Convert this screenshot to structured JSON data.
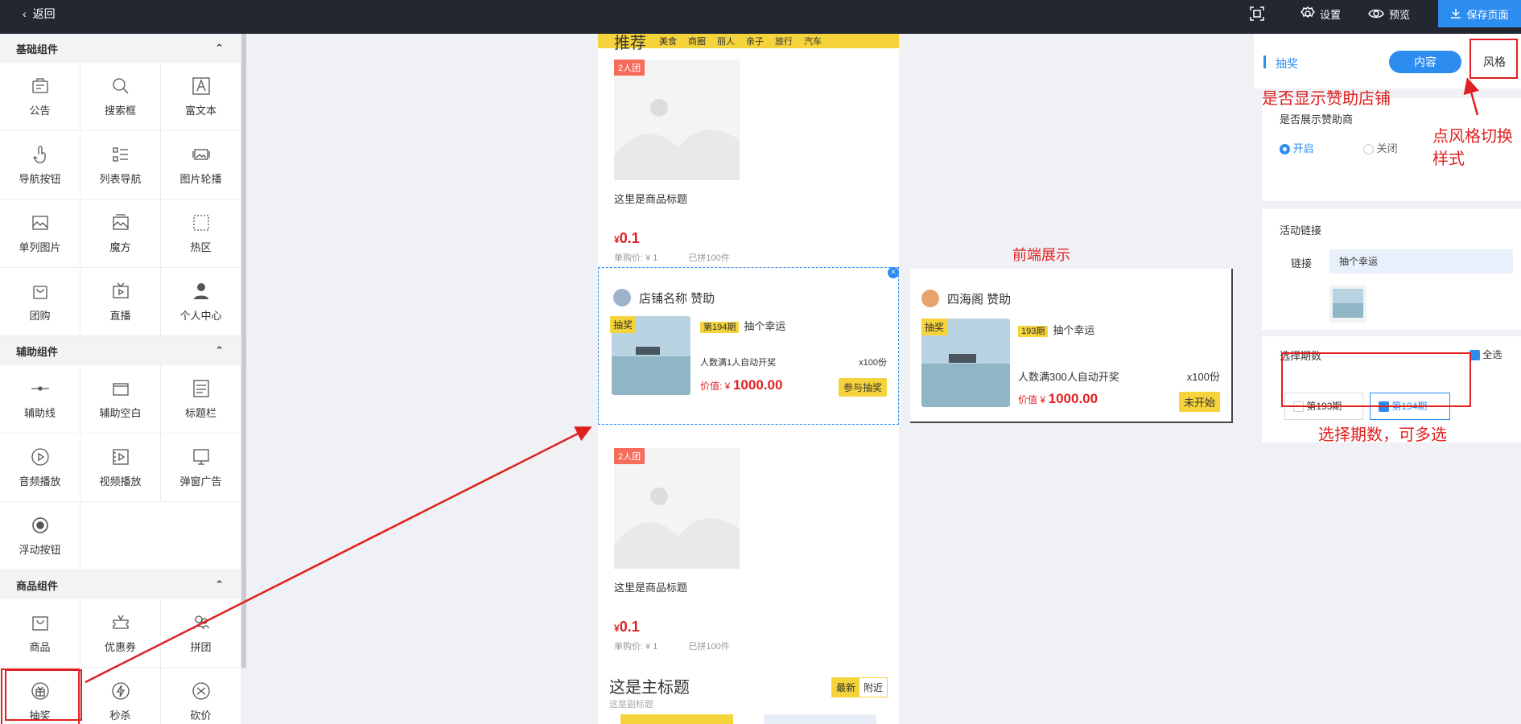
{
  "topbar": {
    "back": "返回",
    "settings": "设置",
    "preview": "预览",
    "save": "保存页面"
  },
  "sidebar": {
    "sections": [
      {
        "title": "基础组件",
        "items": [
          {
            "label": "公告",
            "icon": "notice-icon"
          },
          {
            "label": "搜索框",
            "icon": "search-icon"
          },
          {
            "label": "富文本",
            "icon": "rich-text-icon"
          },
          {
            "label": "导航按钮",
            "icon": "touch-icon"
          },
          {
            "label": "列表导航",
            "icon": "list-icon"
          },
          {
            "label": "图片轮播",
            "icon": "carousel-icon"
          },
          {
            "label": "单列图片",
            "icon": "image-icon"
          },
          {
            "label": "魔方",
            "icon": "cube-icon"
          },
          {
            "label": "热区",
            "icon": "hotspot-icon"
          },
          {
            "label": "团购",
            "icon": "bag-icon"
          },
          {
            "label": "直播",
            "icon": "tv-icon"
          },
          {
            "label": "个人中心",
            "icon": "user-icon"
          }
        ]
      },
      {
        "title": "辅助组件",
        "items": [
          {
            "label": "辅助线",
            "icon": "line-icon"
          },
          {
            "label": "辅助空白",
            "icon": "blank-icon"
          },
          {
            "label": "标题栏",
            "icon": "title-icon"
          },
          {
            "label": "音频播放",
            "icon": "audio-icon"
          },
          {
            "label": "视频播放",
            "icon": "video-icon"
          },
          {
            "label": "弹窗广告",
            "icon": "ad-icon"
          },
          {
            "label": "浮动按钮",
            "icon": "float-button-icon"
          }
        ]
      },
      {
        "title": "商品组件",
        "items": [
          {
            "label": "商品",
            "icon": "goods-icon"
          },
          {
            "label": "优惠券",
            "icon": "coupon-icon"
          },
          {
            "label": "拼团",
            "icon": "group-icon"
          },
          {
            "label": "抽奖",
            "icon": "gift-icon"
          },
          {
            "label": "秒杀",
            "icon": "flash-icon"
          },
          {
            "label": "砍价",
            "icon": "bargain-icon"
          }
        ]
      }
    ]
  },
  "phone": {
    "cats": {
      "main": "推荐",
      "items": [
        "美食",
        "商圈",
        "丽人",
        "亲子",
        "旅行",
        "汽车"
      ]
    },
    "product": {
      "tag": "2人团",
      "title": "这里是商品标题",
      "price": "0.1",
      "currency": "¥",
      "single": "单购价: ¥ 1",
      "sold": "已拼100件"
    },
    "lottery": {
      "shop": "店铺名称 赞助",
      "tag": "抽奖",
      "period": "第194期",
      "name": "抽个幸运",
      "rule": "人数满1人自动开奖",
      "count": "x100份",
      "value_label": "价值: ¥",
      "value": "1000.00",
      "btn": "参与抽奖"
    },
    "title_block": {
      "title": "这是主标题",
      "sub": "这是副标题",
      "tab_new": "最新",
      "tab_near": "附近"
    }
  },
  "frontend": {
    "caption": "前端展示",
    "shop": "四海阁 赞助",
    "tag": "抽奖",
    "period": "193期",
    "name": "抽个幸运",
    "rule": "人数满300人自动开奖",
    "count": "x100份",
    "value_label": "价值 ¥",
    "value": "1000.00",
    "status": "未开始"
  },
  "rpanel": {
    "title": "抽奖",
    "tab_content": "内容",
    "tab_style": "风格",
    "sponsor": {
      "label": "是否展示赞助商",
      "on": "开启",
      "off": "关闭"
    },
    "activity": {
      "label": "活动链接",
      "link_label": "链接",
      "link_value": "抽个幸运"
    },
    "periods": {
      "label": "选择期数",
      "all": "全选",
      "p1": "第193期",
      "p2": "第194期"
    }
  },
  "annotations": {
    "sponsor": "是否显示赞助店铺",
    "style": "点风格切换样式",
    "period": "选择期数，可多选"
  },
  "colors": {
    "accent": "#2d8cf0",
    "topbar": "#222731",
    "yellow": "#f5d33a",
    "red": "#e02020"
  }
}
